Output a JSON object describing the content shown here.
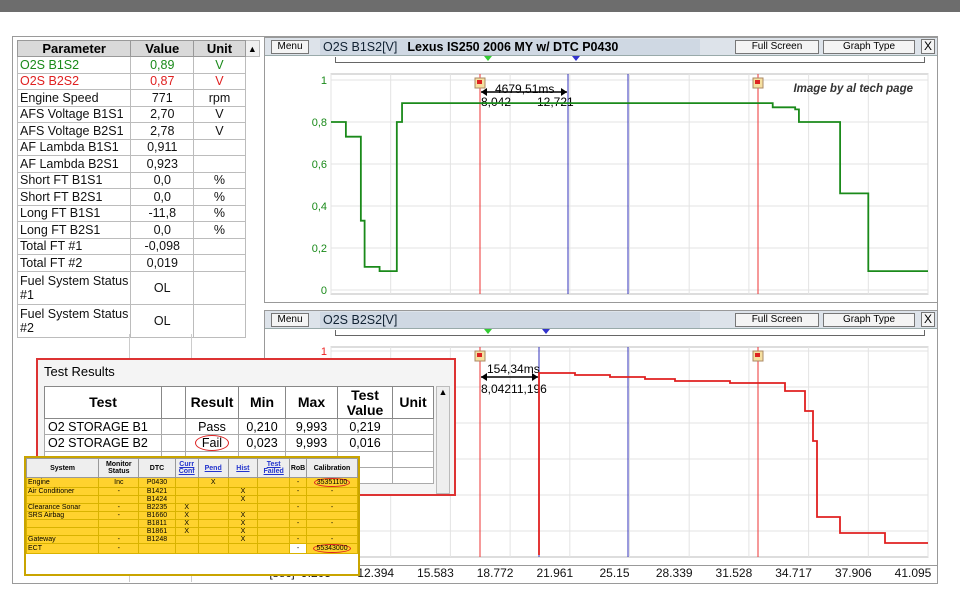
{
  "params": {
    "headers": [
      "Parameter",
      "Value",
      "Unit"
    ],
    "rows": [
      {
        "name": "O2S B1S2",
        "value": "0,89",
        "unit": "V",
        "color": "green"
      },
      {
        "name": "O2S B2S2",
        "value": "0,87",
        "unit": "V",
        "color": "red"
      },
      {
        "name": "Engine Speed",
        "value": "771",
        "unit": "rpm"
      },
      {
        "name": "AFS Voltage B1S1",
        "value": "2,70",
        "unit": "V"
      },
      {
        "name": "AFS Voltage B2S1",
        "value": "2,78",
        "unit": "V"
      },
      {
        "name": "AF Lambda B1S1",
        "value": "0,911",
        "unit": ""
      },
      {
        "name": "AF Lambda B2S1",
        "value": "0,923",
        "unit": ""
      },
      {
        "name": "Short FT B1S1",
        "value": "0,0",
        "unit": "%"
      },
      {
        "name": "Short FT B2S1",
        "value": "0,0",
        "unit": "%"
      },
      {
        "name": "Long FT B1S1",
        "value": "-11,8",
        "unit": "%"
      },
      {
        "name": "Long FT B2S1",
        "value": "0,0",
        "unit": "%"
      },
      {
        "name": "Total FT #1",
        "value": "-0,098",
        "unit": ""
      },
      {
        "name": "Total FT #2",
        "value": "0,019",
        "unit": ""
      },
      {
        "name": "Fuel System Status #1",
        "value": "OL",
        "unit": ""
      },
      {
        "name": "Fuel System Status #2",
        "value": "OL",
        "unit": ""
      }
    ]
  },
  "graph1": {
    "menu": "Menu",
    "channel": "O2S B1S2[V]",
    "title": "Lexus IS250 2006 MY w/ DTC P0430",
    "full_screen": "Full Screen",
    "graph_type": "Graph Type",
    "close": "X",
    "credit": "Image by al tech page",
    "cursor_delta": "4679,51ms",
    "cursor_a": "8,042",
    "cursor_b": "12,721",
    "yticks": [
      "1",
      "0,8",
      "0,6",
      "0,4",
      "0,2",
      "0"
    ]
  },
  "graph2": {
    "menu": "Menu",
    "channel": "O2S B2S2[V]",
    "full_screen": "Full Screen",
    "graph_type": "Graph Type",
    "close": "X",
    "cursor_delta": "154,34ms",
    "cursor_ab": "8,04211,196",
    "yticks": [
      "1"
    ]
  },
  "xaxis": {
    "unit": "[sec]",
    "ticks": [
      "9.205",
      "12.394",
      "15.583",
      "18.772",
      "21.961",
      "25.15",
      "28.339",
      "31.528",
      "34.717",
      "37.906",
      "41.095"
    ]
  },
  "test_results": {
    "title": "Test Results",
    "headers": [
      "Test",
      "",
      "Result",
      "Min",
      "Max",
      "Test Value",
      "Unit"
    ],
    "rows": [
      {
        "test": "O2 STORAGE B1",
        "result": "Pass",
        "min": "0,210",
        "max": "9,993",
        "value": "0,219",
        "unit": ""
      },
      {
        "test": "O2 STORAGE B2",
        "result": "Fail",
        "min": "0,023",
        "max": "9,993",
        "value": "0,016",
        "unit": ""
      }
    ]
  },
  "dtc": {
    "headers": [
      "System",
      "Monitor Status",
      "DTC",
      "Curr Conf",
      "Pend",
      "Hist",
      "Test Failed",
      "RoB",
      "Calibration"
    ],
    "rows": [
      [
        "Engine",
        "Inc",
        "P0430",
        "",
        "X",
        "",
        "",
        "-",
        "35351100"
      ],
      [
        "Air Conditioner",
        "-",
        "B1421",
        "",
        "",
        "X",
        "",
        "-",
        "-"
      ],
      [
        "",
        "",
        "B1424",
        "",
        "",
        "X",
        "",
        "",
        ""
      ],
      [
        "Clearance Sonar",
        "-",
        "B2235",
        "X",
        "",
        "",
        "",
        "-",
        "-"
      ],
      [
        "SRS Airbag",
        "-",
        "B1660",
        "X",
        "",
        "X",
        "",
        "",
        ""
      ],
      [
        "",
        "",
        "B1811",
        "X",
        "",
        "X",
        "",
        "-",
        "-"
      ],
      [
        "",
        "",
        "B1861",
        "X",
        "",
        "X",
        "",
        "",
        ""
      ],
      [
        "Gateway",
        "-",
        "B1248",
        "",
        "",
        "X",
        "",
        "-",
        "-"
      ],
      [
        "ECT",
        "-",
        "",
        "",
        "",
        "",
        "",
        "-",
        "55343000"
      ]
    ]
  },
  "chart_data": [
    {
      "type": "line",
      "title": "O2S B1S2[V]",
      "ylim": [
        0,
        1
      ],
      "x": [
        9.205,
        10.0,
        10.8,
        11.0,
        11.8,
        12.721,
        12.721,
        13.0,
        18.772,
        21.961,
        28.339,
        31.528,
        32.8,
        34.0,
        34.2,
        36.4,
        37.0,
        37.906,
        41.095
      ],
      "series": [
        {
          "name": "O2S B1S2",
          "color": "#1a8a1a",
          "values": [
            0.8,
            0.73,
            0.33,
            0.11,
            0.09,
            0.09,
            0.8,
            0.89,
            0.89,
            0.89,
            0.89,
            0.89,
            0.87,
            0.86,
            0.8,
            0.46,
            0.46,
            0.09,
            0.09
          ]
        }
      ]
    },
    {
      "type": "line",
      "title": "O2S B2S2[V]",
      "x": [
        9.205,
        12.394,
        15.583,
        18.772,
        21.961,
        25.15,
        28.339,
        31.528,
        34.717,
        37.906,
        41.095
      ],
      "series": [
        {
          "name": "O2S B2S2",
          "color": "#e02020"
        }
      ]
    }
  ]
}
